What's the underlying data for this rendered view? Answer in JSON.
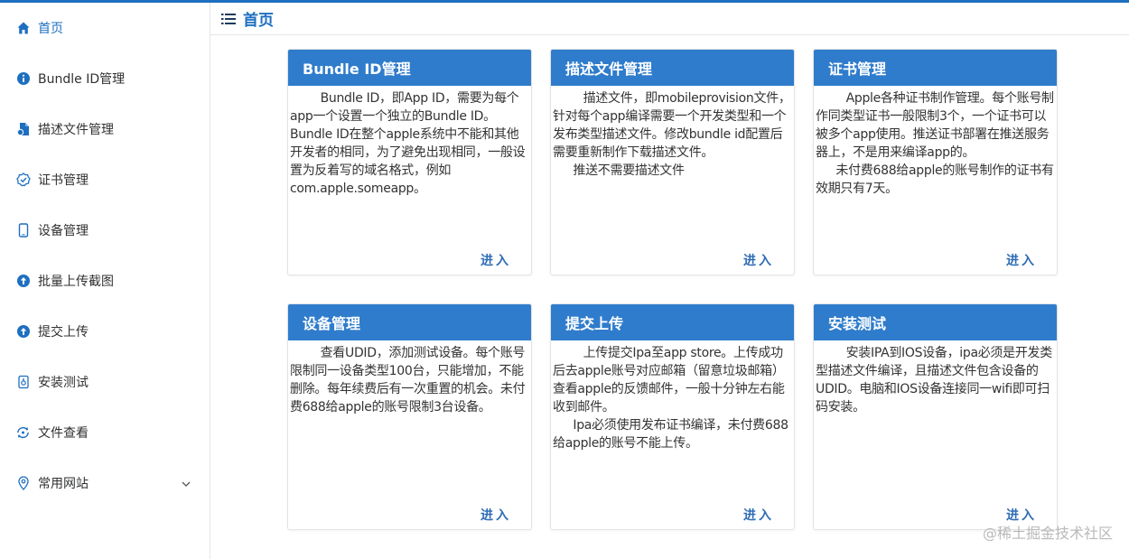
{
  "sidebar": {
    "items": [
      {
        "label": "首页",
        "icon": "home-icon",
        "active": true
      },
      {
        "label": "Bundle ID管理",
        "icon": "info-icon"
      },
      {
        "label": "描述文件管理",
        "icon": "file-icon"
      },
      {
        "label": "证书管理",
        "icon": "certificate-icon"
      },
      {
        "label": "设备管理",
        "icon": "phone-icon"
      },
      {
        "label": "批量上传截图",
        "icon": "upload-icon"
      },
      {
        "label": "提交上传",
        "icon": "upload-icon"
      },
      {
        "label": "安装测试",
        "icon": "install-icon"
      },
      {
        "label": "文件查看",
        "icon": "refresh-icon"
      },
      {
        "label": "常用网站",
        "icon": "location-icon",
        "has_submenu": true
      }
    ]
  },
  "header": {
    "title": "首页",
    "menu_icon": "menu-fold-icon"
  },
  "accent_color": "#2f7ccc",
  "cards": [
    {
      "title": "Bundle ID管理",
      "paragraphs": [
        "Bundle ID，即App ID，需要为每个app一个设置一个独立的Bundle ID。Bundle ID在整个apple系统中不能和其他开发者的相同，为了避免出现相同，一般设置为反着写的域名格式，例如com.apple.someapp。"
      ],
      "enter": "进入"
    },
    {
      "title": "描述文件管理",
      "paragraphs": [
        "描述文件，即mobileprovision文件，针对每个app编译需要一个开发类型和一个发布类型描述文件。修改bundle id配置后需要重新制作下载描述文件。",
        "推送不需要描述文件"
      ],
      "enter": "进入"
    },
    {
      "title": "证书管理",
      "paragraphs": [
        "Apple各种证书制作管理。每个账号制作同类型证书一般限制3个，一个证书可以被多个app使用。推送证书部署在推送服务器上，不是用来编译app的。",
        "未付费688给apple的账号制作的证书有效期只有7天。"
      ],
      "enter": "进入"
    },
    {
      "title": "设备管理",
      "paragraphs": [
        "查看UDID，添加测试设备。每个账号限制同一设备类型100台，只能增加，不能删除。每年续费后有一次重置的机会。未付费688给apple的账号限制3台设备。"
      ],
      "enter": "进入"
    },
    {
      "title": "提交上传",
      "paragraphs": [
        "上传提交Ipa至app store。上传成功后去apple账号对应邮箱（留意垃圾邮箱）查看apple的反馈邮件，一般十分钟左右能收到邮件。",
        "Ipa必须使用发布证书编译，未付费688给apple的账号不能上传。"
      ],
      "enter": "进入"
    },
    {
      "title": "安装测试",
      "paragraphs": [
        "安装IPA到IOS设备，ipa必须是开发类型描述文件编译，且描述文件包含设备的UDID。电脑和IOS设备连接同一wifi即可扫码安装。"
      ],
      "enter": "进入"
    }
  ],
  "watermark": "@稀土掘金技术社区"
}
